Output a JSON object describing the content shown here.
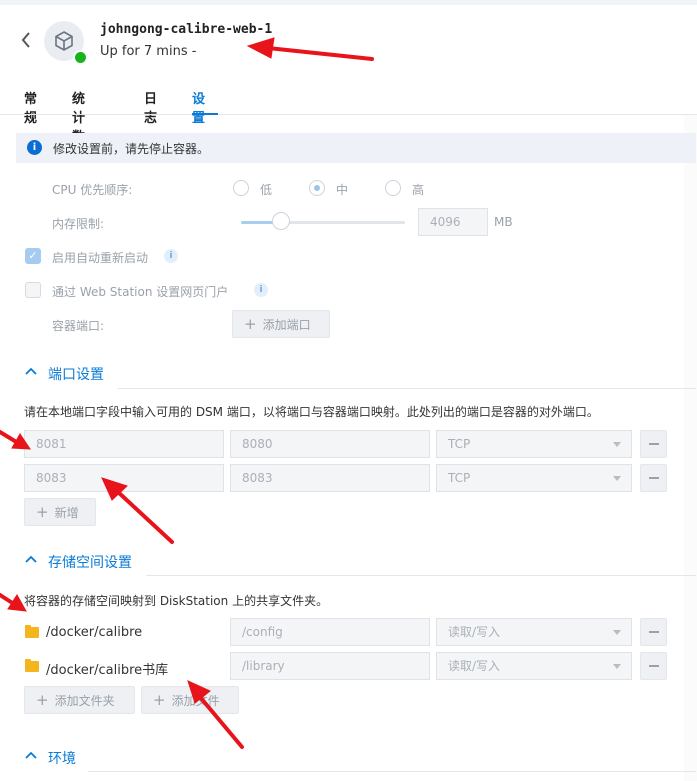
{
  "header": {
    "back_icon": "chevron-left-icon",
    "app_icon": "cube-icon",
    "title": "johngong-calibre-web-1",
    "uptime": "Up for 7 mins -"
  },
  "tabs": [
    {
      "label": "常规",
      "active": false
    },
    {
      "label": "统计数据",
      "active": false
    },
    {
      "label": "日志",
      "active": false
    },
    {
      "label": "设置",
      "active": true
    }
  ],
  "notice": "修改设置前，请先停止容器。",
  "settings": {
    "cpu_label": "CPU 优先顺序:",
    "cpu_options": [
      "低",
      "中",
      "高"
    ],
    "cpu_selected": "中",
    "memory_label": "内存限制:",
    "memory_value": "4096",
    "memory_unit": "MB",
    "auto_restart_label": "启用自动重新启动",
    "auto_restart_checked": true,
    "webstation_label": "通过 Web Station 设置网页门户",
    "webstation_checked": false,
    "container_port_label": "容器端口:",
    "add_port_label": "添加端口"
  },
  "ports": {
    "section_title": "端口设置",
    "description": "请在本地端口字段中输入可用的 DSM 端口，以将端口与容器端口映射。此处列出的端口是容器的对外端口。",
    "rows": [
      {
        "local": "8081",
        "container": "8080",
        "protocol": "TCP"
      },
      {
        "local": "8083",
        "container": "8083",
        "protocol": "TCP"
      }
    ],
    "add_label": "新增"
  },
  "storage": {
    "section_title": "存储空间设置",
    "description": "将容器的存储空间映射到 DiskStation 上的共享文件夹。",
    "rows": [
      {
        "folder": "/docker/calibre",
        "mount": "/config",
        "mode": "读取/写入"
      },
      {
        "folder": "/docker/calibre书库",
        "mount": "/library",
        "mode": "读取/写入"
      }
    ],
    "add_folder_label": "添加文件夹",
    "add_file_label": "添加文件"
  },
  "environment": {
    "section_title": "环境"
  },
  "colors": {
    "accent": "#0a7bd6",
    "status_green": "#17b31b",
    "annotation_red": "#e8141b"
  }
}
